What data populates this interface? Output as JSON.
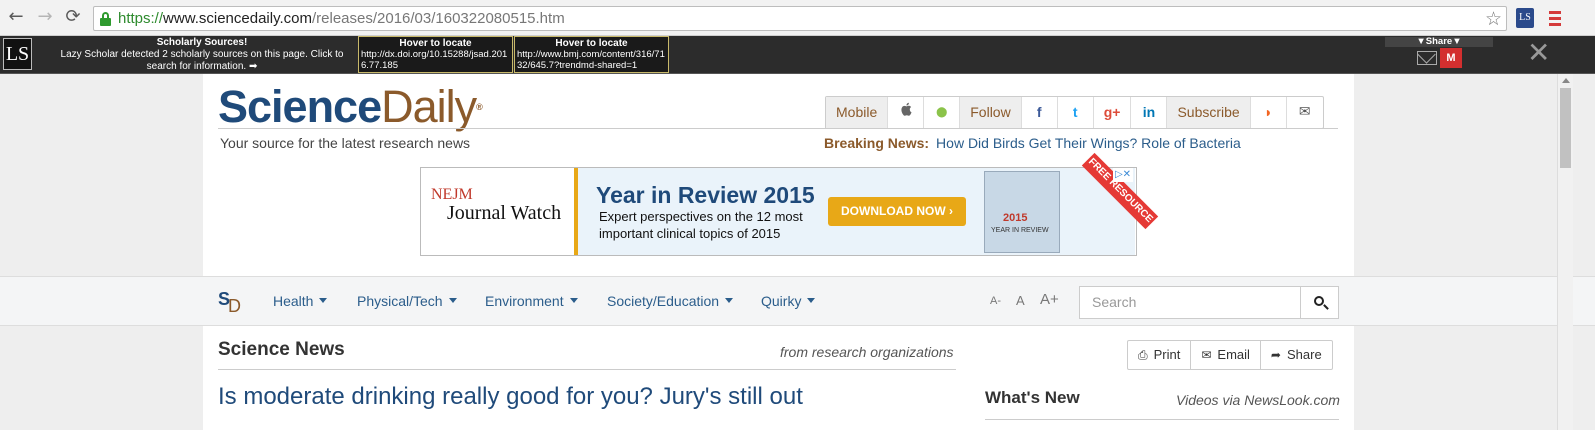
{
  "browser": {
    "url_scheme": "https://",
    "url_domain": "www.sciencedaily.com",
    "url_path": "/releases/2016/03/160322080515.htm",
    "back_icon": "←",
    "forward_icon": "→",
    "reload_icon": "⟳",
    "star_icon": "☆",
    "ext_label": "LS"
  },
  "lazy_scholar": {
    "logo": "LS",
    "title": "Scholarly Sources!",
    "message": "Lazy Scholar detected 2 scholarly sources on this page. Click to search for information. ➡",
    "sources": [
      {
        "heading": "Hover to locate",
        "url": "http://dx.doi.org/10.15288/jsad.2016.77.185"
      },
      {
        "heading": "Hover to locate",
        "url": "http://www.bmj.com/content/316/7132/645.7?trendmd-shared=1"
      }
    ],
    "share_label": "▼Share▼",
    "mendeley_label": "M",
    "close": "✕"
  },
  "site": {
    "logo_science": "Science",
    "logo_daily": "Daily",
    "logo_reg": "®",
    "tagline": "Your source for the latest research news",
    "social": {
      "mobile": "Mobile",
      "apple": "",
      "android": "⬤",
      "follow": "Follow",
      "facebook": "f",
      "twitter": "t",
      "gplus": "g+",
      "linkedin": "in",
      "subscribe": "Subscribe",
      "rss": "◗",
      "email": "✉"
    },
    "breaking_label": "Breaking News:",
    "breaking_text": "How Did Birds Get Their Wings? Role of Bacteria"
  },
  "ad": {
    "nejm": "NEJM",
    "journal_watch": "Journal Watch",
    "title": "Year in Review 2015",
    "subtitle": "Expert perspectives on the 12 most important clinical topics of 2015",
    "button": "DOWNLOAD NOW ›",
    "cover_year": "2015",
    "cover_text": "YEAR IN REVIEW",
    "ribbon": "FREE RESOURCE",
    "choice": "▷✕"
  },
  "nav": {
    "mark_s": "S",
    "mark_d": "D",
    "items": [
      "Health",
      "Physical/Tech",
      "Environment",
      "Society/Education",
      "Quirky"
    ],
    "font_small": "A-",
    "font_normal": "A",
    "font_large": "A+",
    "search_placeholder": "Search"
  },
  "content": {
    "section_title": "Science News",
    "section_from": "from research organizations",
    "headline": "Is moderate drinking really good for you? Jury's still out",
    "actions": {
      "print": "Print",
      "print_icon": "⎙",
      "email": "Email",
      "email_icon": "✉",
      "share": "Share",
      "share_icon": "➦"
    },
    "whats_new": "What's New",
    "videos": "Videos via NewsLook.com"
  }
}
